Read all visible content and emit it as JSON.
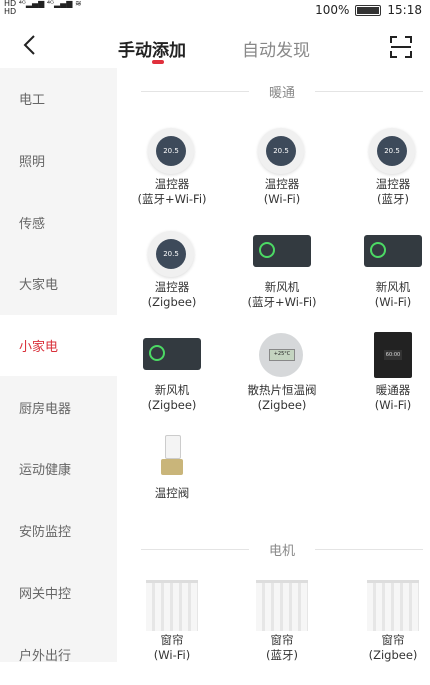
{
  "status": {
    "network": "HD 4G 4G",
    "battery": "100%",
    "time": "15:18"
  },
  "header": {
    "tabs": [
      {
        "label": "手动添加",
        "active": true
      },
      {
        "label": "自动发现",
        "active": false
      }
    ]
  },
  "sidebar": {
    "items": [
      {
        "label": "电工"
      },
      {
        "label": "照明"
      },
      {
        "label": "传感"
      },
      {
        "label": "大家电"
      },
      {
        "label": "小家电",
        "active": true
      },
      {
        "label": "厨房电器"
      },
      {
        "label": "运动健康"
      },
      {
        "label": "安防监控"
      },
      {
        "label": "网关中控"
      },
      {
        "label": "户外出行"
      }
    ]
  },
  "sections": [
    {
      "title": "暖通",
      "devices": [
        {
          "name": "温控器",
          "sub": "(蓝牙+Wi-Fi)",
          "icon": "thermostat-icon",
          "display": "20.5"
        },
        {
          "name": "温控器",
          "sub": "(Wi-Fi)",
          "icon": "thermostat-icon",
          "display": "20.5"
        },
        {
          "name": "温控器",
          "sub": "(蓝牙)",
          "icon": "thermostat-icon",
          "display": "20.5"
        },
        {
          "name": "温控器",
          "sub": "(Zigbee)",
          "icon": "thermostat-icon",
          "display": "20.5"
        },
        {
          "name": "新风机",
          "sub": "(蓝牙+Wi-Fi)",
          "icon": "fresh-air-icon"
        },
        {
          "name": "新风机",
          "sub": "(Wi-Fi)",
          "icon": "fresh-air-icon"
        },
        {
          "name": "新风机",
          "sub": "(Zigbee)",
          "icon": "fresh-air-icon"
        },
        {
          "name": "散热片恒温阀",
          "sub": "(Zigbee)",
          "icon": "radiator-valve-icon"
        },
        {
          "name": "暖通器",
          "sub": "(Wi-Fi)",
          "icon": "heater-icon"
        },
        {
          "name": "温控阀",
          "sub": "",
          "icon": "valve-icon"
        }
      ]
    },
    {
      "title": "电机",
      "devices": [
        {
          "name": "窗帘",
          "sub": "(Wi-Fi)",
          "icon": "curtain-icon"
        },
        {
          "name": "窗帘",
          "sub": "(蓝牙)",
          "icon": "curtain-icon"
        },
        {
          "name": "窗帘",
          "sub": "(Zigbee)",
          "icon": "curtain-icon"
        }
      ]
    }
  ],
  "colors": {
    "accent": "#d9303a",
    "sidebar_bg": "#f5f5f5"
  }
}
